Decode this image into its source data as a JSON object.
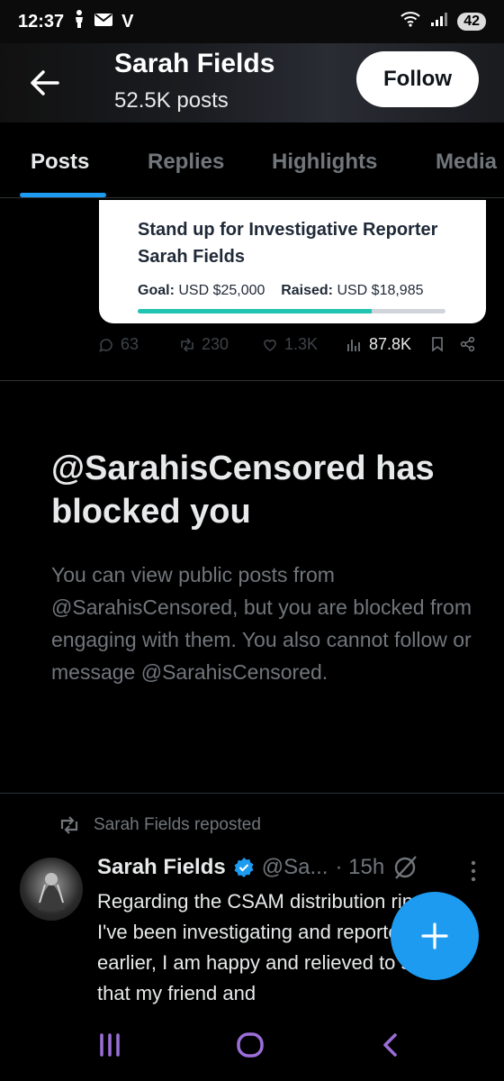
{
  "status_bar": {
    "time": "12:37",
    "carrier_mark": "V",
    "battery_level": "42"
  },
  "header": {
    "title": "Sarah Fields",
    "post_count": "52.5K posts",
    "follow_label": "Follow"
  },
  "tabs": [
    {
      "label": "Posts",
      "active": true
    },
    {
      "label": "Replies"
    },
    {
      "label": "Highlights"
    },
    {
      "label": "Media"
    }
  ],
  "fundraiser": {
    "title": "Stand up for Investigative Reporter Sarah Fields",
    "goal_label": "Goal:",
    "goal_value": "USD $25,000",
    "raised_label": "Raised:",
    "raised_value": "USD $18,985",
    "progress_fraction": 0.7594
  },
  "actions": {
    "replies": "63",
    "reposts": "230",
    "likes": "1.3K",
    "views": "87.8K"
  },
  "blocked": {
    "title": "@SarahisCensored has blocked you",
    "body": "You can view public posts from @SarahisCensored, but you are blocked from engaging with them. You also cannot follow or message @SarahisCensored."
  },
  "repost": {
    "label": "Sarah Fields reposted",
    "author_name": "Sarah Fields",
    "author_handle": "@Sa...",
    "time": "· 15h",
    "text": "Regarding the CSAM distribution ring I've been investigating and reported on earlier, I am happy and relieved to say that my friend and"
  },
  "colors": {
    "accent": "#1d9bf0",
    "progress_fill": "#20c4b0",
    "muted_text": "#71767b"
  },
  "icons": [
    "back-arrow-icon",
    "reply-icon",
    "repost-icon",
    "like-icon",
    "views-icon",
    "bookmark-icon",
    "share-icon",
    "verified-badge-icon",
    "grok-icon",
    "more-icon",
    "compose-plus-icon"
  ]
}
